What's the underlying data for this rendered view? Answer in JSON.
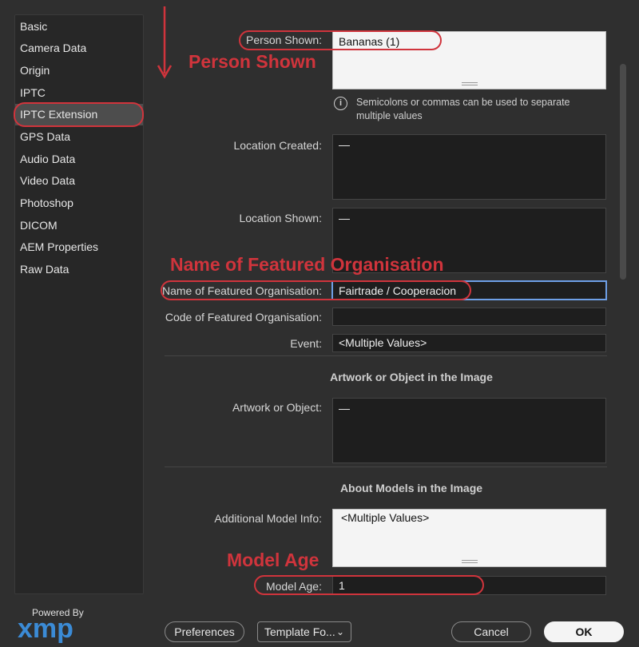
{
  "sidebar": {
    "items": [
      {
        "label": "Basic"
      },
      {
        "label": "Camera Data"
      },
      {
        "label": "Origin"
      },
      {
        "label": "IPTC"
      },
      {
        "label": "IPTC Extension"
      },
      {
        "label": "GPS Data"
      },
      {
        "label": "Audio Data"
      },
      {
        "label": "Video Data"
      },
      {
        "label": "Photoshop"
      },
      {
        "label": "DICOM"
      },
      {
        "label": "AEM Properties"
      },
      {
        "label": "Raw Data"
      }
    ],
    "selected": "IPTC Extension",
    "powered_by": "Powered By",
    "logo_text": "xmp"
  },
  "fields": {
    "person_shown": {
      "label": "Person Shown:",
      "value": "Bananas (1)"
    },
    "hint": "Semicolons or commas can be used to separate multiple values",
    "location_created": {
      "label": "Location Created:",
      "value": "—"
    },
    "location_shown": {
      "label": "Location Shown:",
      "value": "—"
    },
    "featured_org_name": {
      "label": "Name of Featured Organisation:",
      "value": "Fairtrade / Cooperacion"
    },
    "featured_org_code": {
      "label": "Code of Featured Organisation:",
      "value": ""
    },
    "event": {
      "label": "Event:",
      "value": "<Multiple Values>"
    },
    "artwork": {
      "label": "Artwork or Object:",
      "value": "—"
    },
    "additional_model_info": {
      "label": "Additional Model Info:",
      "value": "<Multiple Values>"
    },
    "model_age": {
      "label": "Model Age:",
      "value": "1"
    }
  },
  "sections": {
    "artwork_title": "Artwork or Object in the Image",
    "models_title": "About Models in the Image"
  },
  "annotations": {
    "person_shown": "Person Shown",
    "featured_org": "Name of Featured Organisation",
    "model_age": "Model Age",
    "color": "#d0343c"
  },
  "footer": {
    "preferences": "Preferences",
    "template": "Template Fo...",
    "cancel": "Cancel",
    "ok": "OK"
  }
}
